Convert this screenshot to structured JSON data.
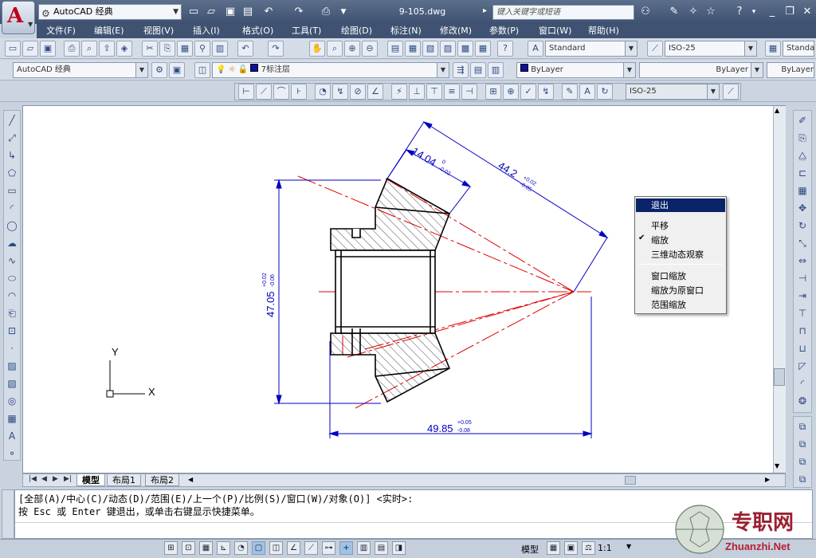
{
  "titlebar": {
    "workspace": "AutoCAD 经典",
    "doc_title": "9-105.dwg",
    "search_placeholder": "键入关键字或短语",
    "help_caret": "▾"
  },
  "menu": [
    "文件(F)",
    "编辑(E)",
    "视图(V)",
    "插入(I)",
    "格式(O)",
    "工具(T)",
    "绘图(D)",
    "标注(N)",
    "修改(M)",
    "参数(P)",
    "窗口(W)",
    "帮助(H)"
  ],
  "toolbar": {
    "text_style": "Standard",
    "dim_style": "ISO-25",
    "dim_style_short": "Standa",
    "workspace2": "AutoCAD 经典",
    "layer": "7标注层",
    "color": "ByLayer",
    "linetype": "ByLayer",
    "lineweight": "ByLayer",
    "dim_style_dim": "ISO-25"
  },
  "drawing": {
    "dim_top": "14.04",
    "dim_top_tol_up": "0",
    "dim_top_tol_low": "-0.02",
    "dim_diag": "44.2",
    "dim_diag_tol_up": "+0.02",
    "dim_diag_tol_low": "-0.05",
    "dim_left": "47.05",
    "dim_left_tol_up": "+0.02",
    "dim_left_tol_low": "-0.06",
    "dim_bottom": "49.85",
    "dim_bottom_tol_up": "+0.05",
    "dim_bottom_tol_low": "-0.08",
    "ucs_x": "X",
    "ucs_y": "Y"
  },
  "context_menu": {
    "items_group1": [
      "退出",
      "平移",
      "缩放",
      "三维动态观察"
    ],
    "items_group2": [
      "窗口缩放",
      "缩放为原窗口",
      "范围缩放"
    ],
    "checked": "缩放",
    "check_mark": "✔"
  },
  "tabs": [
    "模型",
    "布局1",
    "布局2"
  ],
  "command": {
    "line1": "[全部(A)/中心(C)/动态(D)/范围(E)/上一个(P)/比例(S)/窗口(W)/对象(O)] <实时>:",
    "line2": "按 Esc 或 Enter 键退出，或单击右键显示快捷菜单。"
  },
  "status": {
    "model_label": "模型",
    "scale": "1:1"
  },
  "watermark": {
    "brand": "专职网",
    "url": "Zhuanzhi.Net"
  },
  "colors": {
    "titlebar": "#4a5d7e",
    "dim_blue": "#0000c0",
    "center_red": "#e00000",
    "menu_highlight": "#0a246a"
  }
}
